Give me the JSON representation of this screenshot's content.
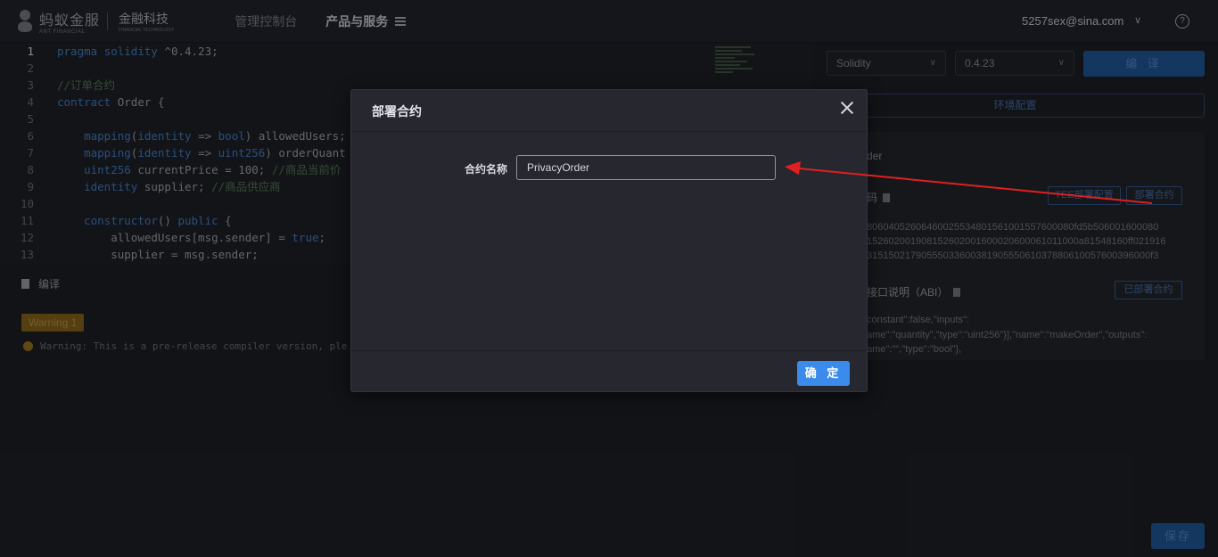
{
  "header": {
    "logo_cn": "蚂蚁金服",
    "logo_en": "ANT FINANCIAL",
    "logo_sub_cn": "金融科技",
    "logo_sub_en": "FINANCIAL TECHNOLOGY",
    "nav_console": "管理控制台",
    "nav_products": "产品与服务",
    "user_email": "5257sex@sina.com",
    "user_chevron": "∨",
    "help_symbol": "?"
  },
  "editor": {
    "lines": [
      {
        "n": "1",
        "code": "pragma solidity ^0.4.23;"
      },
      {
        "n": "2",
        "code": ""
      },
      {
        "n": "3",
        "code": "//订单合约"
      },
      {
        "n": "4",
        "code": "contract Order {"
      },
      {
        "n": "5",
        "code": ""
      },
      {
        "n": "6",
        "code": "    mapping(identity => bool) allowedUsers;"
      },
      {
        "n": "7",
        "code": "    mapping(identity => uint256) orderQuant"
      },
      {
        "n": "8",
        "code": "    uint256 currentPrice = 100; //商品当前价"
      },
      {
        "n": "9",
        "code": "    identity supplier; //商品供应商"
      },
      {
        "n": "10",
        "code": ""
      },
      {
        "n": "11",
        "code": "    constructor() public {"
      },
      {
        "n": "12",
        "code": "        allowedUsers[msg.sender] = true;"
      },
      {
        "n": "13",
        "code": "        supplier = msg.sender;"
      }
    ],
    "compile_label": "编译",
    "warning_badge": "Warning 1",
    "warning_text": "Warning: This is a pre-release compiler version, ple"
  },
  "right_panel": {
    "language": "Solidity",
    "version": "0.4.23",
    "compile_button": "编 译",
    "env_button": "环境配置",
    "contract_name_suffix": "der",
    "bytecode_title": "码",
    "bytecode_lines": [
      "80604052606460025534801561001557600080fd5b506001600080",
      "152602001908152602001600020600061011000a81548160ff021916",
      "3151502179055503360038190555061037880610057600396000f3"
    ],
    "btn_copy_deploy": "TEE部署配置",
    "btn_deploy": "部署合约",
    "abi_title": "接口说明（ABI）",
    "btn_deployed": "已部署合约",
    "abi_lines": [
      "constant\":false,\"inputs\":",
      "ame\":\"quantity\",\"type\":\"uint256\"}],\"name\":\"makeOrder\",\"outputs\":",
      "ame\":\"\",\"type\":\"bool\"},"
    ],
    "save_button": "保存"
  },
  "modal": {
    "title": "部署合约",
    "field_label": "合约名称",
    "field_value": "PrivacyOrder",
    "ok_button": "确 定"
  },
  "colors": {
    "accent": "#3b8bec",
    "annotation_arrow": "#e02020"
  }
}
